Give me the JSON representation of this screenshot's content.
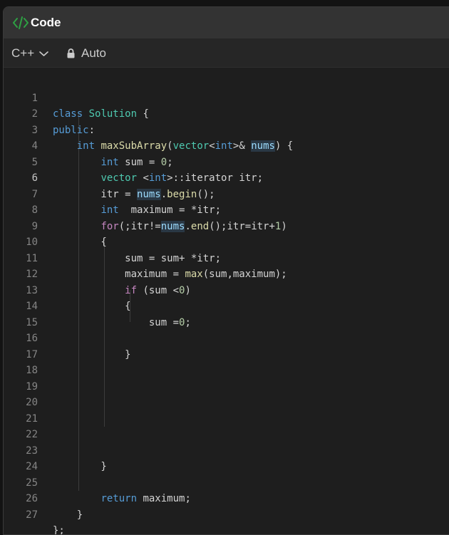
{
  "header": {
    "title": "Code",
    "icon": "code-brackets-icon",
    "icon_color": "#2ea043"
  },
  "toolbar": {
    "language": "C++",
    "mode": "Auto"
  },
  "editor": {
    "active_line": 6,
    "line_numbers": [
      "1",
      "2",
      "3",
      "4",
      "5",
      "6",
      "7",
      "8",
      "9",
      "10",
      "11",
      "12",
      "13",
      "14",
      "15",
      "16",
      "17",
      "18",
      "19",
      "20",
      "21",
      "22",
      "23",
      "24",
      "25",
      "26",
      "27"
    ],
    "lines": [
      "class Solution {",
      "public:",
      "    int maxSubArray(vector<int>& nums) {",
      "        int sum = 0;",
      "        vector <int>::iterator itr;",
      "        itr = nums.begin();",
      "        int  maximum = *itr;",
      "        for(;itr!=nums.end();itr=itr+1)",
      "        {",
      "            sum = sum+ *itr;",
      "            maximum = max(sum,maximum);",
      "            if (sum <0)",
      "            {",
      "                sum =0;",
      "",
      "            }",
      "",
      "",
      "",
      "",
      "",
      "",
      "        }",
      "",
      "        return maximum;",
      "    }",
      "};"
    ]
  }
}
